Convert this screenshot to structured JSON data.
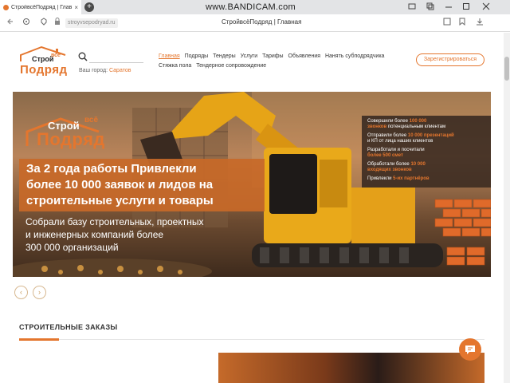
{
  "browser": {
    "tab_title": "СтройвсёПодряд | Глав",
    "tab_close": "×",
    "new_tab": "+",
    "recorder_watermark": "www.BANDICAM.com",
    "url": "stroyvsepodryad.ru",
    "page_title": "СтройвсёПодряд | Главная",
    "icons": [
      "back-icon",
      "forward-icon",
      "reload-icon",
      "shield-icon",
      "bookmark-icon",
      "download-icon",
      "minimize-icon",
      "maximize-icon",
      "close-icon"
    ]
  },
  "header": {
    "logo": {
      "part1": "Строй",
      "part1_super": "всё",
      "part2": "Подряд"
    },
    "city_label": "Ваш город:",
    "city_value": "Саратов",
    "menu_row1": [
      "Главная",
      "Подряды",
      "Тендеры",
      "Услуги",
      "Тарифы",
      "Объявления",
      "Нанять субподрядчика"
    ],
    "menu_row2": [
      "Стяжка пола",
      "Тендерное сопровождение"
    ],
    "register_label": "Зарегистрироваться"
  },
  "banner": {
    "logo": {
      "part1": "Строй",
      "part1_super": "всё",
      "part2": "Подряд"
    },
    "headline": [
      "За 2 года работы Привлекли",
      "более 10 000 заявок и лидов на",
      "строительные услуги и товары"
    ],
    "subline": [
      "Собрали базу строительных, проектных",
      "и инженерных компаний более",
      "300 000 организаций"
    ],
    "stats": [
      {
        "lines": [
          [
            "Совершили более ",
            "100 000"
          ],
          [
            "звонков",
            " потенциальным клиентам"
          ]
        ]
      },
      {
        "lines": [
          [
            "Отправили более ",
            "10 000 презентаций"
          ],
          [
            "и КП от лица наших клиентов",
            ""
          ]
        ]
      },
      {
        "lines": [
          [
            "Разработали и посчитали",
            ""
          ],
          [
            "более 500 смет",
            ""
          ]
        ]
      },
      {
        "lines": [
          [
            "Обработали более ",
            "10 000"
          ],
          [
            "входящих звонков",
            ""
          ]
        ]
      },
      {
        "lines": [
          [
            "Привлекли ",
            "5-их партнёров"
          ]
        ]
      }
    ]
  },
  "slider": {
    "prev": "‹",
    "next": "›"
  },
  "section": {
    "title": "СТРОИТЕЛЬНЫЕ ЗАКАЗЫ"
  },
  "colors": {
    "accent": "#e4762e",
    "text": "#333333"
  }
}
